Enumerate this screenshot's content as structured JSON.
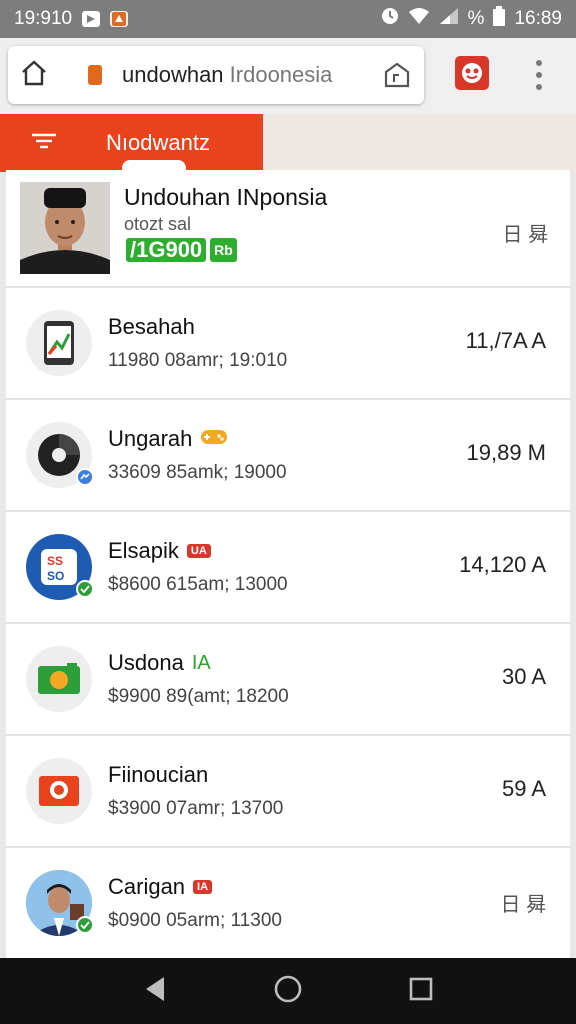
{
  "status_bar": {
    "time_left": "19:910",
    "battery_text": "%",
    "time_right": "16:89"
  },
  "browser": {
    "url_main": "undowhan ",
    "url_dim": "Irdoonesia"
  },
  "tab": {
    "label": "Nıodwantz"
  },
  "profile": {
    "name": "Undouhan INponsia",
    "subtitle": "otozt sal",
    "badge_amount": "/1G900",
    "badge_currency": "Rb",
    "right_text": "日 曻"
  },
  "rows": [
    {
      "title": "Besahah",
      "tag": "",
      "subtitle": "11980 08amr; 19:010",
      "amount": "11,/7A A"
    },
    {
      "title": "Ungarah",
      "tag": "",
      "subtitle": "33609 85amk; 19000",
      "amount": "19,89 M"
    },
    {
      "title": "Elsapik",
      "tag": "UA",
      "subtitle": "$8600 615am; 13000",
      "amount": "14,120 A"
    },
    {
      "title": "Usdona",
      "tag": "IA",
      "subtitle": "$9900 89(amt; 18200",
      "amount": "30 A"
    },
    {
      "title": "Fiinoucian",
      "tag": "",
      "subtitle": "$3900 07amr; 13700",
      "amount": "59 A"
    },
    {
      "title": "Carigan",
      "tag": "IA",
      "subtitle": "$0900 05arm; 11300",
      "amount": "日 曻"
    }
  ],
  "colors": {
    "accent": "#e8431c",
    "badge_green": "#2eae2e",
    "status_bar": "#7d7d7d",
    "nav_bar": "#111111"
  }
}
